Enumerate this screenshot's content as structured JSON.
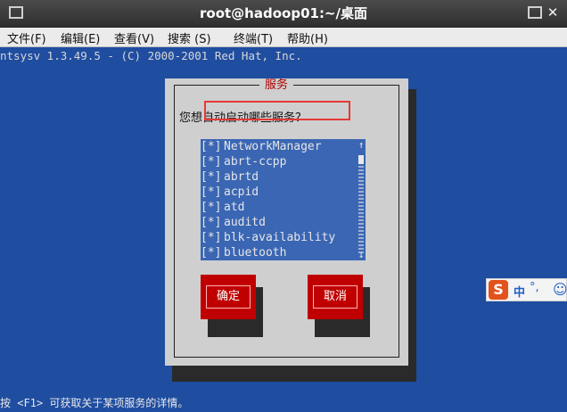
{
  "window": {
    "title": "root@hadoop01:~/桌面"
  },
  "menu": {
    "items": [
      "文件(F)",
      "编辑(E)",
      "查看(V)",
      "搜索 (S)",
      "终端(T)",
      "帮助(H)"
    ]
  },
  "terminal": {
    "header": "ntsysv 1.3.49.5 - (C) 2000-2001 Red Hat, Inc.",
    "footer": "按 <F1> 可获取关于某项服务的详情。"
  },
  "dialog": {
    "title": "服务",
    "prompt": "您想自动启动哪些服务？",
    "services": [
      {
        "mark": "[*]",
        "name": "NetworkManager"
      },
      {
        "mark": "[*]",
        "name": "abrt-ccpp"
      },
      {
        "mark": "[*]",
        "name": "abrtd"
      },
      {
        "mark": "[*]",
        "name": "acpid"
      },
      {
        "mark": "[*]",
        "name": "atd"
      },
      {
        "mark": "[*]",
        "name": "auditd"
      },
      {
        "mark": "[*]",
        "name": "blk-availability"
      },
      {
        "mark": "[*]",
        "name": "bluetooth"
      }
    ],
    "ok_label": "确定",
    "cancel_label": "取消"
  },
  "ime": {
    "logo": "S",
    "mode": "中",
    "punct": "°,",
    "emoji": "☺"
  },
  "colors": {
    "terminal_bg": "#1f4da0",
    "dialog_bg": "#cfcfcf",
    "list_bg": "#3a66b4",
    "button_red": "#c00000",
    "highlight": "#e53935"
  }
}
